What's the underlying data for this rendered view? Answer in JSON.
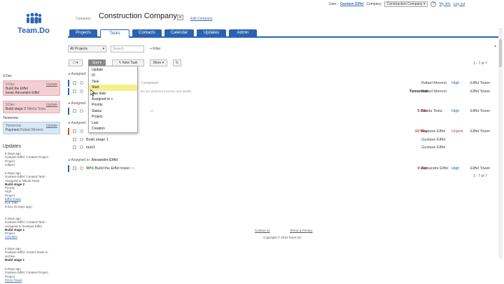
{
  "topbar": {
    "user_label": "User:",
    "user_name": "Gustave Eiffel",
    "company_label": "Company",
    "company_select": "Construction Company",
    "help_icon": "?",
    "my_info": "My info",
    "logout": "Log out"
  },
  "logo": {
    "icon": "people-icon",
    "text": "Team.Do"
  },
  "company": {
    "label": "Company",
    "title": "Construction Company",
    "edit": "Edit Company"
  },
  "tabs": [
    "Projects",
    "Tasks",
    "Contacts",
    "Calendar",
    "Updates",
    "Admin"
  ],
  "filters": {
    "projects_select": "All Projects",
    "search_placeholder": "Search",
    "filter_link": "+ Filter"
  },
  "toolbar": {
    "check_select": "□ ▾",
    "sort_btn": "Sort ▾",
    "new_task": "New Task",
    "more_btn": "More ▾",
    "refresh": "↻"
  },
  "pager_top": "1 - 7 of 7",
  "pager_bottom": "1 - 7 of 7",
  "sort_menu": [
    "Update",
    "ID",
    "Task",
    "Start",
    "Due date",
    "Assigned to +",
    "Priority",
    "Status",
    "Project",
    "Last",
    "Creation"
  ],
  "left": {
    "day1": "9 Dec",
    "cards_day1": [
      {
        "when": "9 Dec",
        "upd": "Update",
        "title": "Build the Eiffel",
        "sub": "tower  Alexandre Eiffel"
      },
      {
        "when": "9 Dec",
        "upd": "Update",
        "title": "Build stage 2",
        "sub": "Nikola Tesla"
      }
    ],
    "day2": "Tomorrow",
    "card_day2": {
      "when": "Tomorrow",
      "upd": "Update",
      "title": "Payment",
      "sub": "Rafael Moreno"
    },
    "updates_title": "Updates",
    "updates": [
      {
        "lines": [
          "5 Days ago",
          "Gustave Eiffel: Created Project",
          "Project",
          "subject"
        ]
      },
      {
        "lines": [
          "6 Days ago",
          "Gustave Eiffel: Created Task -",
          "Assigned to Nikola Tesla"
        ],
        "strong": "Build stage 2",
        "extra": [
          "Priority",
          "High",
          "Project",
          "Eiffel Tower",
          "Due Date",
          "9 Dec (6 Days ago)"
        ]
      },
      {
        "lines": [
          "6 Days ago",
          "Gustave Eiffel: Created Task -",
          "Assigned to Gustave Eiffel"
        ],
        "strong": "Build stage 1",
        "extra": [
          "Project",
          "Activities"
        ]
      },
      {
        "lines": [
          "6 Days ago",
          "Gustave Eiffel: moved Stack to",
          "archive"
        ],
        "strong": "Build stage 1",
        "extra": []
      },
      {
        "lines": [
          "6 Days ago",
          "Gustave Eiffel: Created Project",
          "Project",
          "Pizza Travel"
        ]
      }
    ]
  },
  "groups": {
    "g1": "Assigned",
    "g2": "Assigned",
    "g3": "Assigned",
    "g4_prefix": "Assigned to:",
    "g4_name": "Alexandre Eiffel"
  },
  "rows": [
    {
      "name": "",
      "note": "Completed",
      "date": "",
      "assignee": "Rafael Moreno",
      "prio": "High",
      "proj": "Eiffel Tower",
      "bar": "#2a63b3"
    },
    {
      "name": "",
      "note": "ies are attached invoices and details",
      "date": "Tomorrow",
      "assignee": "Rafael Moreno",
      "prio": "",
      "proj": "Eiffel Tower",
      "bar": "#2a63b3"
    },
    {
      "name": "",
      "note": "",
      "date": "9 Dec",
      "assignee": "Nikola Tesla",
      "prio": "High",
      "proj": "Eiffel Tower",
      "bar": "#2a63b3"
    },
    {
      "name": "",
      "note": "",
      "date": "10 May",
      "assignee": "Gustave Eiffel",
      "prio": "Urgent",
      "proj": "Eiffel Tower",
      "bar": "#d35400"
    },
    {
      "name": "Build stage 1",
      "note": "",
      "date": "",
      "assignee": "Gustave Eiffel",
      "prio": "",
      "proj": "",
      "bar": ""
    },
    {
      "name": "task1",
      "note": "",
      "date": "",
      "assignee": "Gustave Eiffel",
      "prio": "",
      "proj": "",
      "bar": ""
    },
    {
      "name": "Build the Eiffel tower",
      "pct": "90%",
      "note": "",
      "date": "9 Dec",
      "assignee": "Alexandre Eiffel",
      "prio": "High",
      "proj": "Eiffel Tower",
      "bar": "#2a63b3"
    }
  ],
  "footer": {
    "contact": "Contact us",
    "terms": "Terms & Privacy",
    "copyright": "Copyright © 2010 Team.Do"
  }
}
